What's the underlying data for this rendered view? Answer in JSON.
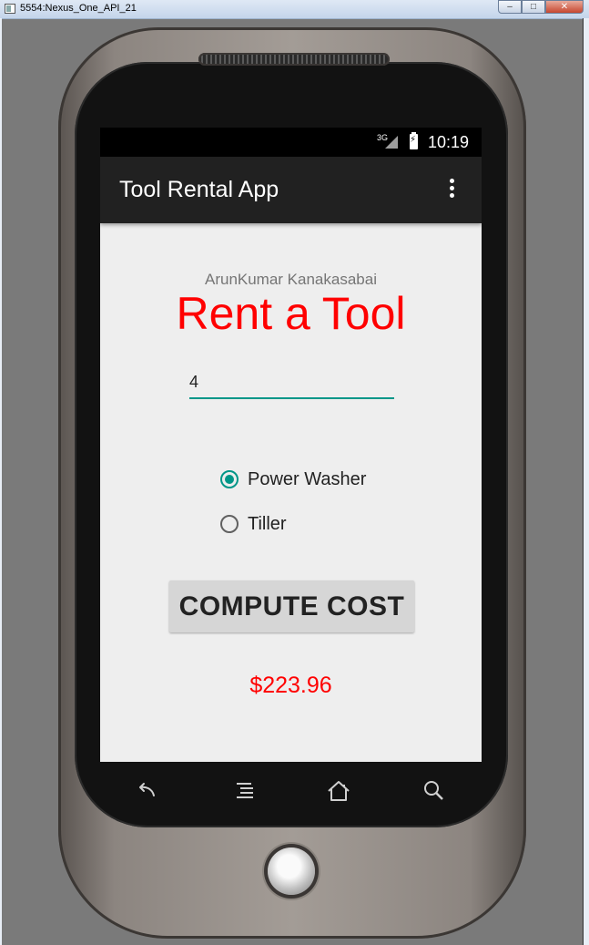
{
  "window": {
    "title": "5554:Nexus_One_API_21",
    "minimize": "–",
    "maximize": "□",
    "close": "✕"
  },
  "status_bar": {
    "network": "3G",
    "time": "10:19"
  },
  "app_bar": {
    "title": "Tool Rental App",
    "overflow_icon": "more-vert-icon"
  },
  "main": {
    "author": "ArunKumar Kanakasabai",
    "headline": "Rent a Tool",
    "quantity_value": "4",
    "radio_options": [
      {
        "label": "Power Washer",
        "selected": true
      },
      {
        "label": "Tiller",
        "selected": false
      }
    ],
    "compute_button_label": "COMPUTE COST",
    "cost_result": "$223.96"
  },
  "nav_keys": {
    "back": "back-icon",
    "menu": "menu-icon",
    "home": "home-icon",
    "search": "search-icon"
  },
  "colors": {
    "accent": "#009688",
    "headline": "#ff0000",
    "app_bar": "#212121",
    "screen_bg": "#eeeeee"
  }
}
